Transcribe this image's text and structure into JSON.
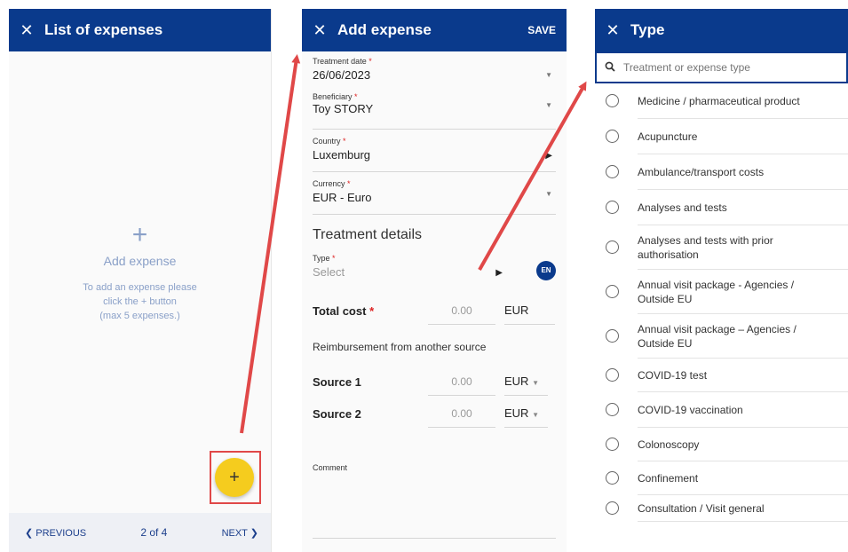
{
  "list_panel": {
    "title": "List of expenses",
    "add_label": "Add expense",
    "hint_lines": [
      "To add an expense please",
      "click the + button",
      "(max 5 expenses.)"
    ],
    "fab_label": "+",
    "pager": {
      "previous": "❮ PREVIOUS",
      "count": "2 of 4",
      "next": "NEXT ❯"
    }
  },
  "add_panel": {
    "title": "Add expense",
    "save": "SAVE",
    "treatment_date": {
      "label": "Treatment date",
      "value": "26/06/2023"
    },
    "beneficiary": {
      "label": "Beneficiary",
      "value": "Toy STORY"
    },
    "country": {
      "label": "Country",
      "value": "Luxemburg"
    },
    "currency": {
      "label": "Currency",
      "value": "EUR - Euro"
    },
    "section_title": "Treatment details",
    "type": {
      "label": "Type",
      "placeholder": "Select",
      "lang": "EN"
    },
    "total_cost": {
      "label": "Total cost",
      "amount": "0.00",
      "currency": "EUR"
    },
    "reimbursement_label": "Reimbursement from another source",
    "source1": {
      "label": "Source 1",
      "amount": "0.00",
      "currency": "EUR"
    },
    "source2": {
      "label": "Source 2",
      "amount": "0.00",
      "currency": "EUR"
    },
    "comment_label": "Comment",
    "required_mark": "*"
  },
  "type_panel": {
    "title": "Type",
    "search_placeholder": "Treatment or expense type",
    "options": [
      "Medicine / pharmaceutical product",
      "Acupuncture",
      "Ambulance/transport costs",
      "Analyses and tests",
      "Analyses and tests with prior authorisation",
      "Annual visit package - Agencies / Outside EU",
      "Annual visit package – Agencies / Outside EU",
      "COVID-19 test",
      "COVID-19 vaccination",
      "Colonoscopy",
      "Confinement",
      "Consultation / Visit general"
    ]
  },
  "icons": {
    "close": "close-icon",
    "search": "search-icon",
    "caret": "caret-down-icon"
  },
  "colors": {
    "header": "#0a3a8c",
    "fab": "#f5cc1e",
    "annotation": "#e04848",
    "muted": "#8aa0c8"
  }
}
